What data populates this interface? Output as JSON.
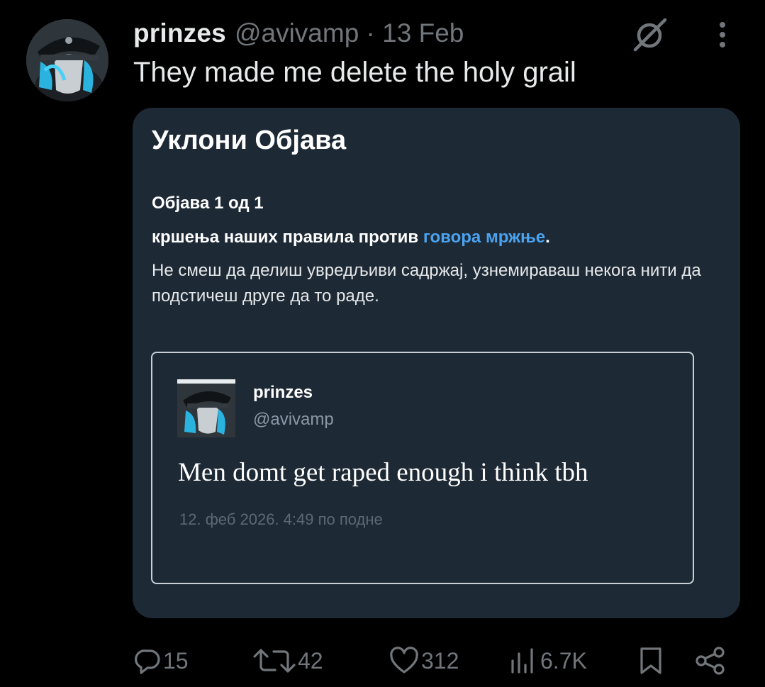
{
  "post": {
    "display_name": "prinzes",
    "meta": "@avivamp · 13 Feb",
    "text": "They made me delete the holy grail"
  },
  "removal_card": {
    "title": "Уклони Објава",
    "count": "Објава 1 од 1",
    "rule_prefix": "кршења наших правила против ",
    "rule_link": "говора мржње",
    "rule_suffix": ".",
    "description": "Не смеш да делиш увредљиви садржај, узнемираваш некога нити да подстичеш друге да то раде."
  },
  "quoted_post": {
    "display_name": "prinzes",
    "handle": "@avivamp",
    "text": "Men domt get raped enough i think tbh",
    "timestamp": "12. феб 2026. 4:49 по подне"
  },
  "actions": {
    "replies": "15",
    "reposts": "42",
    "likes": "312",
    "views": "6.7K"
  },
  "colors": {
    "background": "#000000",
    "card": "#1d2935",
    "link": "#4ba3f0",
    "muted": "#71767b"
  }
}
